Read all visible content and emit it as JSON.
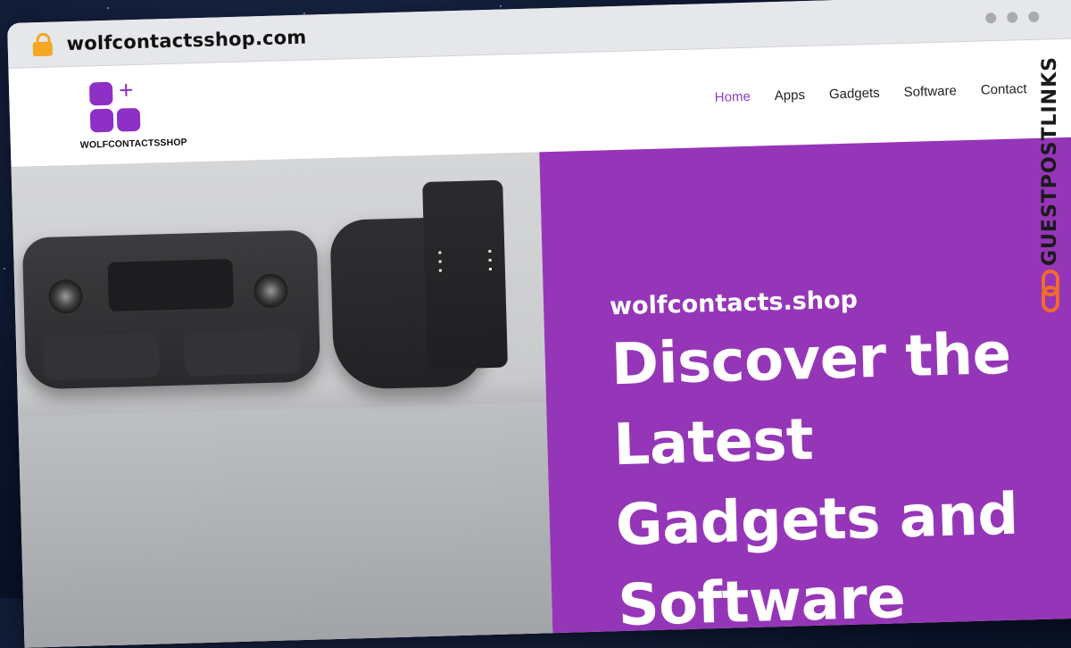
{
  "browser": {
    "url": "wolfcontactsshop.com",
    "icons": [
      "lock-icon",
      "window-dots-icon"
    ]
  },
  "site": {
    "logo_text": "WOLFCONTACTSSHOP",
    "nav": [
      {
        "label": "Home",
        "active": true
      },
      {
        "label": "Apps",
        "active": false
      },
      {
        "label": "Gadgets",
        "active": false
      },
      {
        "label": "Software",
        "active": false
      },
      {
        "label": "Contact",
        "active": false
      }
    ]
  },
  "hero": {
    "site_name": "wolfcontacts.shop",
    "title": "Discover the Latest Gadgets and Software"
  },
  "badge": {
    "text": "GUESTPOSTLINKS"
  },
  "colors": {
    "brand_purple": "#9536b8",
    "nav_active": "#8e3bbf",
    "badge_orange": "#f26b2a"
  }
}
